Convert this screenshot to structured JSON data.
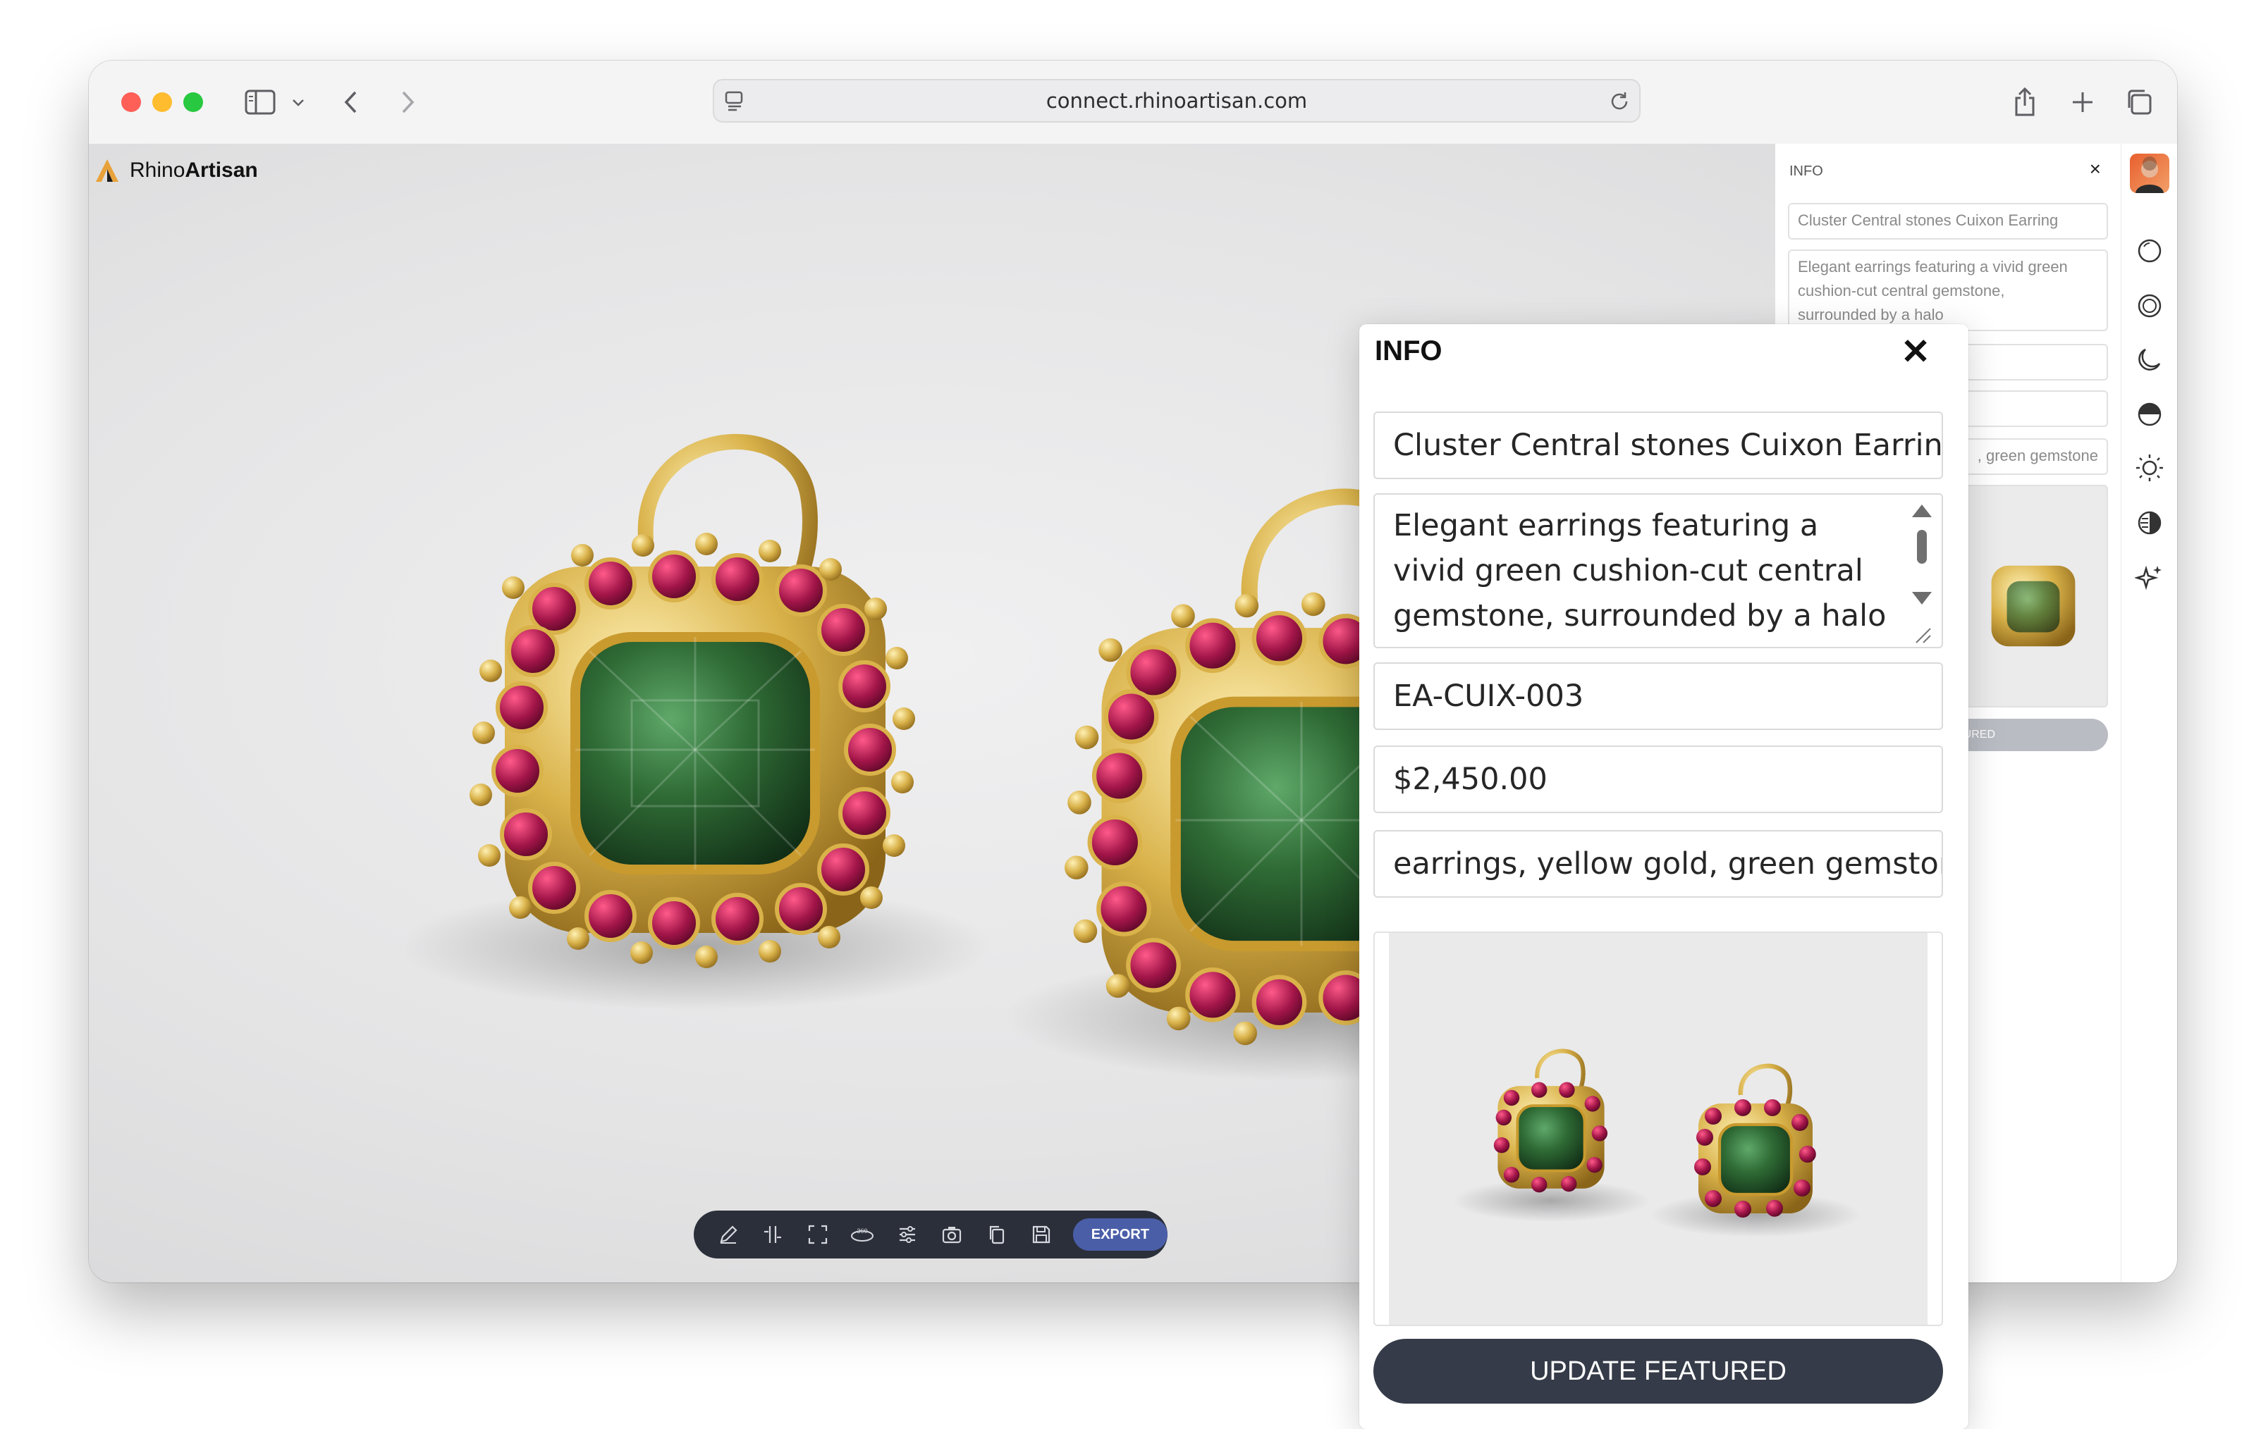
{
  "browser": {
    "url": "connect.rhinoartisan.com"
  },
  "app": {
    "brand_light": "Rhino",
    "brand_bold": "Artisan"
  },
  "toolbar": {
    "export_label": "EXPORT",
    "tools": [
      "pencil-icon",
      "crosshair-icon",
      "frame-icon",
      "rotate-360-icon",
      "sliders-icon",
      "camera-icon",
      "copy-icon",
      "save-icon"
    ]
  },
  "background_panel": {
    "header": "INFO",
    "close": "×",
    "name_value": "Cluster Central stones Cuixon Earring",
    "description_value": "Elegant earrings featuring a vivid green cushion-cut central gemstone, surrounded by a halo",
    "tags_value": ", green gemstone",
    "featured_fragment": "TURED"
  },
  "rail": {
    "icons": [
      "circle-outline-icon",
      "sphere-icon",
      "moon-icon",
      "environment-icon",
      "sun-icon",
      "contrast-icon",
      "sparkle-icon"
    ]
  },
  "info_panel": {
    "title": "INFO",
    "close": "✕",
    "name_value": "Cluster Central stones Cuixon Earring",
    "description_value": "Elegant earrings featuring a vivid green cushion-cut central gemstone, surrounded by a halo",
    "sku_value": "EA-CUIX-003",
    "price_value": "$2,450.00",
    "tags_value": "earrings, yellow gold, green gemstone",
    "update_label": "UPDATE FEATURED"
  },
  "colors": {
    "gold": "#d9b24a",
    "emerald": "#2f6b35",
    "ruby": "#a21548",
    "dark_button": "#353b48",
    "export_accent": "#4a5ea8"
  }
}
